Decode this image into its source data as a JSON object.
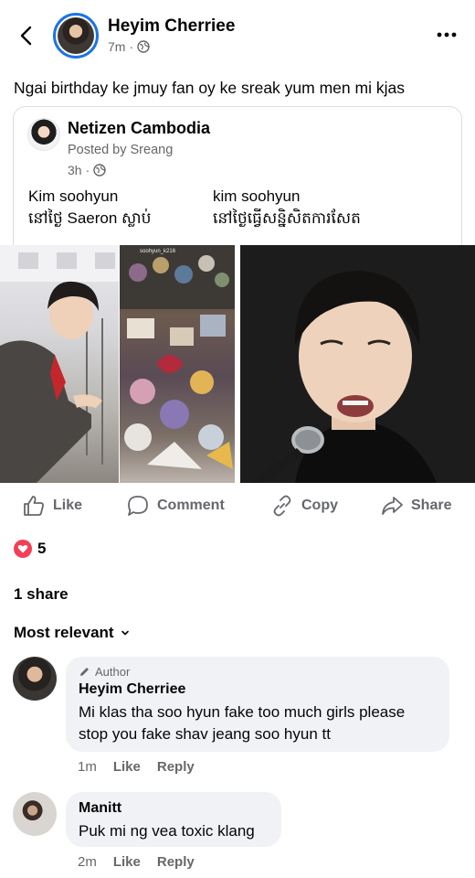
{
  "header": {
    "author_name": "Heyim Cherriee",
    "time": "7m",
    "privacy_icon": "globe-icon"
  },
  "post": {
    "text": "Ngai birthday ke jmuy fan oy ke sreak yum men mi kjas"
  },
  "shared_post": {
    "page_name": "Netizen Cambodia",
    "posted_by": "Posted by Sreang",
    "time": "3h",
    "left_text_line1": "Kim soohyun",
    "left_text_line2": "នៅថ្ងៃ Saeron ស្លាប់",
    "right_text_line1": "kim soohyun",
    "right_text_line2": "នៅថ្ងៃធ្វើសន្និសិតការសែត",
    "photo_watermark": "soohyun_k216"
  },
  "actions": {
    "like": "Like",
    "comment": "Comment",
    "copy": "Copy",
    "share": "Share"
  },
  "reactions": {
    "count": "5",
    "type": "love"
  },
  "shares": "1 share",
  "sort": {
    "label": "Most relevant"
  },
  "comments": [
    {
      "badge": "Author",
      "name": "Heyim Cherriee",
      "text_line1": "Mi klas tha soo hyun fake too much girls please",
      "text_line2": "stop you fake shav jeang soo hyun tt",
      "time": "1m",
      "like": "Like",
      "reply": "Reply"
    },
    {
      "name": "Manitt",
      "text": "Puk mi ng vea toxic klang",
      "time": "2m",
      "like": "Like",
      "reply": "Reply"
    }
  ],
  "colors": {
    "accent": "#1b74e4",
    "secondary_text": "#65676b",
    "bubble": "#f0f2f5",
    "love": "#f33e58"
  }
}
